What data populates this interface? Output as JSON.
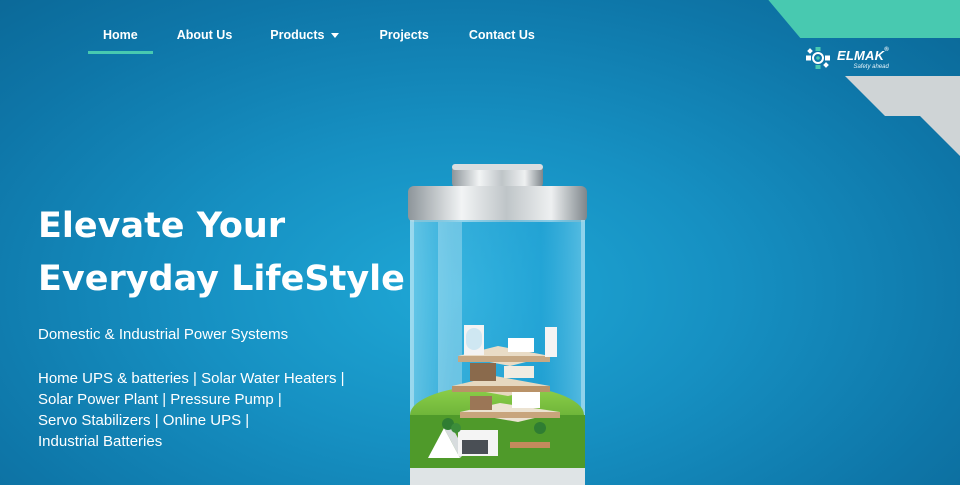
{
  "nav": {
    "items": [
      {
        "label": "Home",
        "active": true
      },
      {
        "label": "About Us"
      },
      {
        "label": "Products",
        "dropdown": true
      },
      {
        "label": "Projects"
      },
      {
        "label": "Contact Us"
      }
    ]
  },
  "brand": {
    "name": "ELMAK",
    "trademark": "®",
    "tagline": "Safety ahead"
  },
  "hero": {
    "title_line1": "Elevate Your",
    "title_line2": "Everyday LifeStyle",
    "subtitle": "Domestic & Industrial Power Systems",
    "services_lines": [
      "Home UPS & batteries | Solar Water Heaters |",
      "Solar Power Plant | Pressure Pump |",
      "Servo Stabilizers | Online UPS |",
      "Industrial Batteries"
    ],
    "image_description": "battery-house-illustration"
  },
  "colors": {
    "accent": "#48c9b0",
    "background": "#1690c2",
    "stripe_grey": "#cfd4d6",
    "text": "#ffffff"
  }
}
